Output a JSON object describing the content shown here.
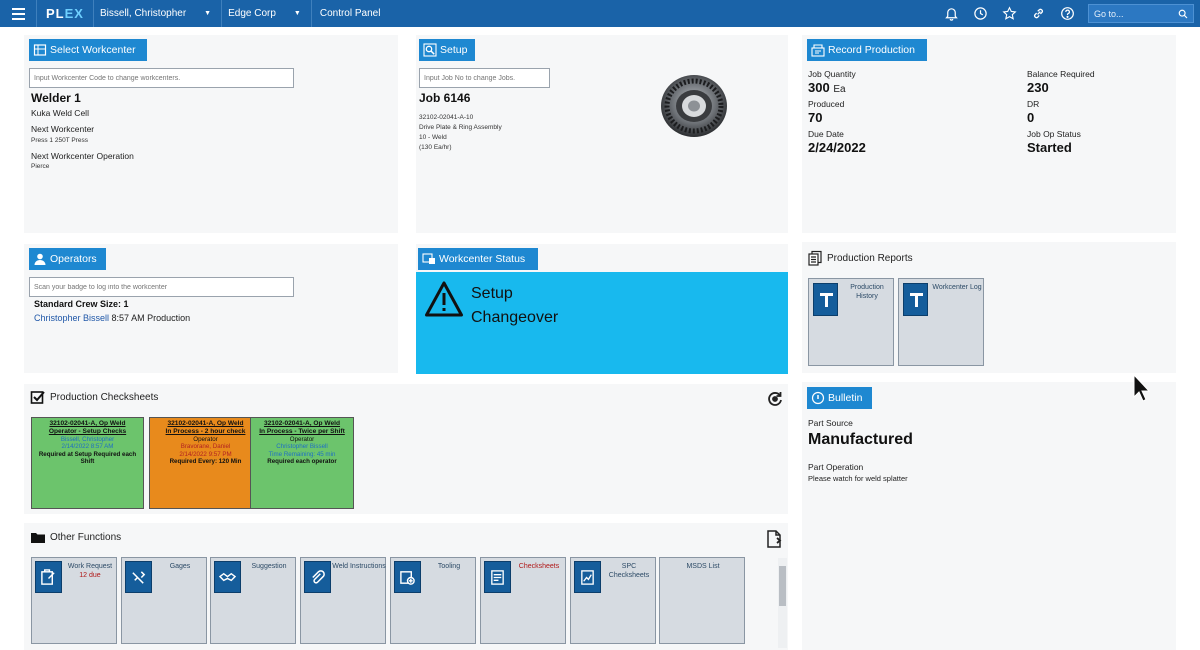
{
  "topbar": {
    "logo_left": "PL",
    "logo_right": "EX",
    "user": "Bissell, Christopher",
    "company": "Edge Corp",
    "control_panel": "Control Panel",
    "goto_placeholder": "Go to..."
  },
  "select_workcenter": {
    "button": "Select Workcenter",
    "input_placeholder": "Input Workcenter Code to change workcenters.",
    "name": "Welder 1",
    "cell": "Kuka Weld Cell",
    "next_wc_label": "Next Workcenter",
    "next_wc_value": "Press 1 250T Press",
    "next_op_label": "Next Workcenter Operation",
    "next_op_value": "Pierce"
  },
  "setup": {
    "button": "Setup",
    "input_placeholder": "Input Job No to change Jobs.",
    "job": "Job 6146",
    "part_no": "32102-02041-A-10",
    "part_desc": "Drive Plate & Ring Assembly",
    "op": "10 - Weld",
    "rate": "(130 Ea/hr)"
  },
  "record_production": {
    "button": "Record Production",
    "job_qty_label": "Job Quantity",
    "job_qty_value": "300",
    "job_qty_unit": "Ea",
    "balance_label": "Balance Required",
    "balance_value": "230",
    "produced_label": "Produced",
    "produced_value": "70",
    "dr_label": "DR",
    "dr_value": "0",
    "due_label": "Due Date",
    "due_value": "2/24/2022",
    "status_label": "Job Op Status",
    "status_value": "Started"
  },
  "operators": {
    "button": "Operators",
    "input_placeholder": "Scan your badge to log into the workcenter",
    "crew_size": "Standard Crew Size: 1",
    "operator_name": "Christopher Bissell",
    "operator_time": "8:57 AM Production"
  },
  "workcenter_status": {
    "button": "Workcenter Status",
    "line1": "Setup",
    "line2": "Changeover"
  },
  "production_reports": {
    "title": "Production Reports",
    "tiles": [
      {
        "label": "Production History"
      },
      {
        "label": "Workcenter Log"
      }
    ]
  },
  "bulletin": {
    "button": "Bulletin",
    "part_source_label": "Part Source",
    "part_source_value": "Manufactured",
    "part_op_label": "Part Operation",
    "part_op_value": "Please watch for weld splatter"
  },
  "checksheets": {
    "title": "Production Checksheets",
    "cards": [
      {
        "title1": "32102-02041-A, Op Weld",
        "title2": "Operator - Setup Checks",
        "name": "Bissell, Christopher",
        "date": "2/14/2022 8:57 AM",
        "req": "Required at Setup Required each Shift",
        "color": "#6cc46c"
      },
      {
        "title1": "32102-02041-A, Op Weld",
        "title2": "In Process - 2 hour check",
        "name": "Operator",
        "date": "Bravorane, Daniel",
        "req": "2/14/2022 9:57 PM",
        "req2": "Required Every: 120 Min",
        "color": "#e88a1c"
      },
      {
        "title1": "32102-02041-A, Op Weld",
        "title2": "In Process - Twice per Shift",
        "name": "Operator",
        "date": "Christopher Bissell",
        "req": "Time Remaining: 45 min",
        "req2": "Required each operator",
        "color": "#6cc46c"
      }
    ]
  },
  "other_functions": {
    "title": "Other Functions",
    "tiles": [
      {
        "label": "Work Request",
        "sub": "12 due"
      },
      {
        "label": "Gages"
      },
      {
        "label": "Suggestion"
      },
      {
        "label": "Weld Instructions"
      },
      {
        "label": "Tooling"
      },
      {
        "label": "Checksheets"
      },
      {
        "label": "SPC Checksheets"
      },
      {
        "label": "MSDS List"
      }
    ]
  }
}
